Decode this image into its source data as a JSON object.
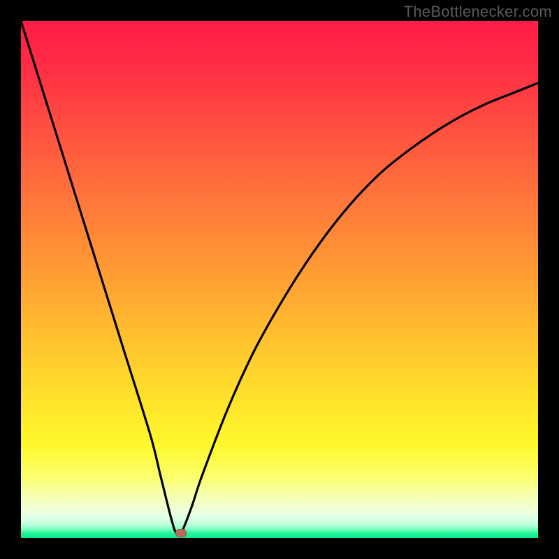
{
  "watermark": "TheBottlenecker.com",
  "chart_data": {
    "type": "line",
    "title": "",
    "xlabel": "",
    "ylabel": "",
    "xlim": [
      0,
      100
    ],
    "ylim": [
      0,
      100
    ],
    "x": [
      0,
      5,
      10,
      15,
      20,
      25,
      27,
      29,
      30,
      31,
      33,
      35,
      40,
      45,
      50,
      55,
      60,
      65,
      70,
      75,
      80,
      85,
      90,
      95,
      100
    ],
    "y": [
      100,
      84,
      68,
      52,
      36,
      20,
      12,
      4,
      1,
      1,
      6,
      12,
      25,
      36,
      45,
      53,
      60,
      66,
      71,
      75,
      78.5,
      81.5,
      84,
      86,
      88
    ],
    "marker": {
      "x": 31,
      "y": 1
    },
    "gradient_colors": {
      "top": "#ff1c47",
      "mid_upper": "#ffa033",
      "mid_lower": "#fff82c",
      "bottom": "#08e88e"
    }
  }
}
